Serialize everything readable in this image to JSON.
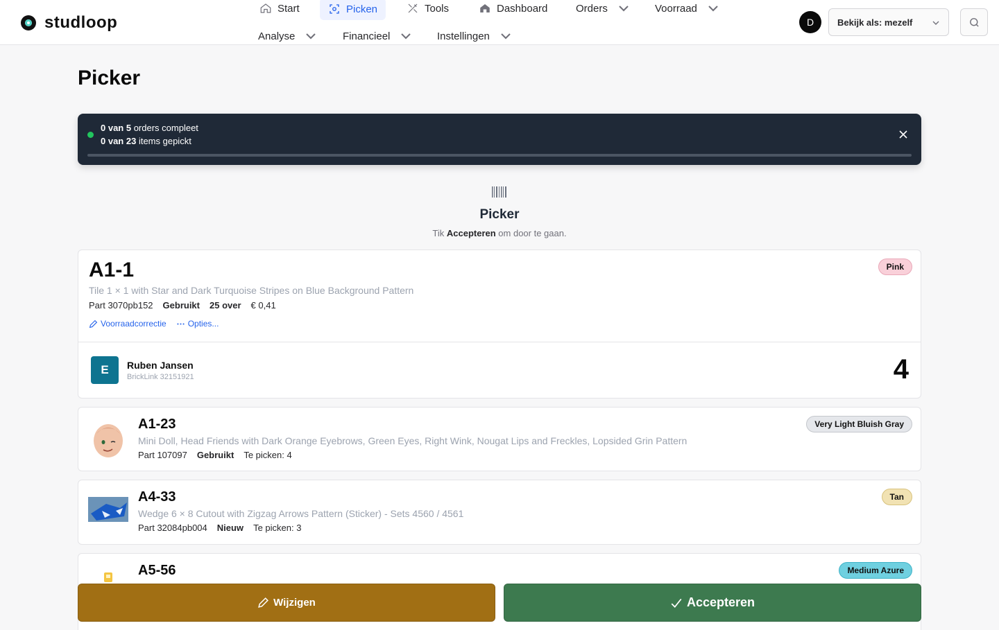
{
  "brand": {
    "name": "studloop"
  },
  "nav": {
    "start": "Start",
    "picken": "Picken",
    "tools": "Tools",
    "dashboard": "Dashboard",
    "orders": "Orders",
    "voorraad": "Voorraad",
    "analyse": "Analyse",
    "financieel": "Financieel",
    "instellingen": "Instellingen"
  },
  "user": {
    "initial": "D",
    "view_as": "Bekijk als: mezelf"
  },
  "page": {
    "title": "Picker"
  },
  "progress": {
    "orders_done": "0 van 5",
    "orders_suffix": " orders compleet",
    "items_done": "0 van 23",
    "items_suffix": " items gepickt",
    "fraction": 0
  },
  "picker": {
    "title": "Picker",
    "hint_pre": "Tik ",
    "hint_bold": "Accepteren",
    "hint_post": " om door te gaan."
  },
  "current": {
    "location": "A1-1",
    "color": "Pink",
    "description": "Tile 1 × 1 with Star and Dark Turquoise Stripes on Blue Background Pattern",
    "part": "Part 3070pb152",
    "condition": "Gebruikt",
    "stock": "25 over",
    "price": "€ 0,41",
    "action_correct": "Voorraadcorrectie",
    "action_options": "Opties...",
    "customer": {
      "initial": "E",
      "name": "Ruben Jansen",
      "order": "BrickLink 32151921",
      "qty": "4"
    }
  },
  "queue": [
    {
      "location": "A1-23",
      "color": "Very Light Bluish Gray",
      "description": "Mini Doll, Head Friends with Dark Orange Eyebrows, Green Eyes, Right Wink, Nougat Lips and Freckles, Lopsided Grin Pattern",
      "part": "Part 107097",
      "condition": "Gebruikt",
      "to_pick": "Te picken: 4"
    },
    {
      "location": "A4-33",
      "color": "Tan",
      "description": "Wedge 6 × 8 Cutout with Zigzag Arrows Pattern (Sticker) - Sets 4560 / 4561",
      "part": "Part 32084pb004",
      "condition": "Nieuw",
      "to_pick": "Te picken: 3"
    },
    {
      "location": "A5-56",
      "color": "Medium Azure"
    }
  ],
  "buttons": {
    "edit": "Wijzigen",
    "accept": "Accepteren"
  },
  "colors": {
    "pink": "#f9d0d9",
    "gray": "#e5e7eb",
    "tan": "#f1e2b3",
    "azure": "#6fd0e0",
    "edit": "#a16f14",
    "accept": "#3d7a4f"
  }
}
